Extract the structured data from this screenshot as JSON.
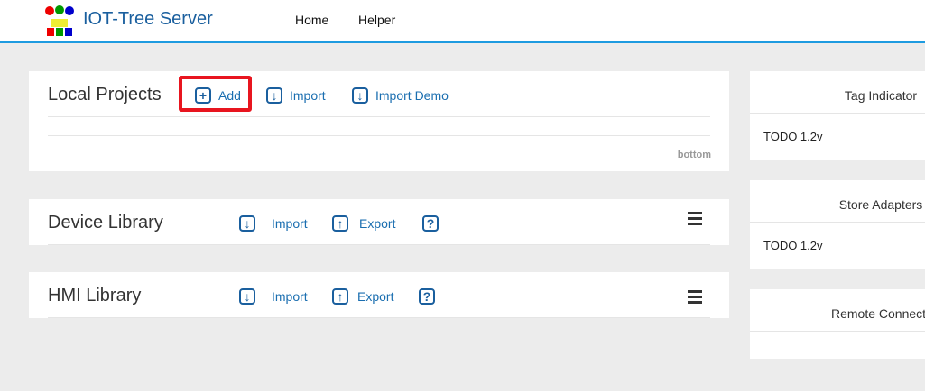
{
  "header": {
    "title": "IOT-Tree Server",
    "nav": [
      "Home",
      "Helper"
    ]
  },
  "local": {
    "title": "Local Projects",
    "add": "Add",
    "import": "Import",
    "import_demo": "Import Demo",
    "bottom": "bottom"
  },
  "device": {
    "title": "Device Library",
    "import": "Import",
    "export": "Export",
    "help": "?"
  },
  "hmi": {
    "title": "HMI Library",
    "import": "Import",
    "export": "Export",
    "help": "?"
  },
  "right": [
    {
      "title": "Tag Indicator",
      "body": "TODO 1.2v"
    },
    {
      "title": "Store Adapters",
      "body": "TODO 1.2v"
    },
    {
      "title": "Remote Connection",
      "body": ""
    }
  ],
  "highlight": "#e8151f"
}
